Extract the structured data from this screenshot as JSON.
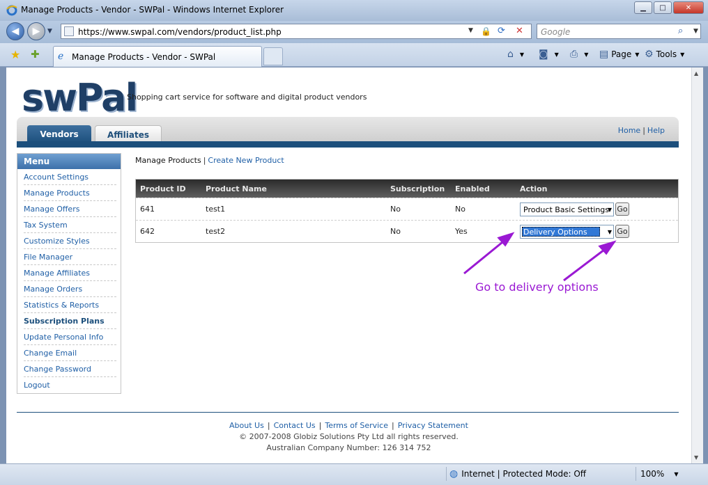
{
  "window": {
    "title": "Manage Products - Vendor - SWPal - Windows Internet Explorer",
    "buttons": {
      "minimize": "▁",
      "maximize": "□",
      "close": "✕"
    }
  },
  "address": {
    "url": "https://www.swpal.com/vendors/product_list.php",
    "search_placeholder": "Google"
  },
  "tabs": {
    "active_label": "Manage Products - Vendor - SWPal",
    "commands": {
      "page": "Page",
      "tools": "Tools"
    }
  },
  "site": {
    "logo": "swPal",
    "tagline": "Shopping cart service for software and digital product vendors",
    "main_tabs": [
      "Vendors",
      "Affiliates"
    ],
    "top_links": {
      "home": "Home",
      "help": "Help"
    }
  },
  "menu": {
    "header": "Menu",
    "items": [
      "Account Settings",
      "Manage Products",
      "Manage Offers",
      "Tax System",
      "Customize Styles",
      "File Manager",
      "Manage Affiliates",
      "Manage Orders",
      "Statistics & Reports",
      "Subscription Plans",
      "Update Personal Info",
      "Change Email",
      "Change Password",
      "Logout"
    ]
  },
  "breadcrumb": {
    "current": "Manage Products",
    "link": "Create New Product"
  },
  "table": {
    "headers": [
      "Product ID",
      "Product Name",
      "Subscription",
      "Enabled",
      "Action"
    ],
    "rows": [
      {
        "id": "641",
        "name": "test1",
        "subscription": "No",
        "enabled": "No",
        "action": "Product Basic Settings",
        "go": "Go"
      },
      {
        "id": "642",
        "name": "test2",
        "subscription": "No",
        "enabled": "Yes",
        "action": "Delivery Options",
        "go": "Go"
      }
    ]
  },
  "annotation": {
    "text": "Go to delivery options",
    "color": "#9a19d3"
  },
  "footer": {
    "links": [
      "About Us",
      "Contact Us",
      "Terms of Service",
      "Privacy Statement"
    ],
    "copyright": "© 2007-2008 Globiz Solutions Pty Ltd all rights reserved.",
    "acn": "Australian Company Number: 126 314 752"
  },
  "status": {
    "zone": "Internet | Protected Mode: Off",
    "zoom": "100%"
  },
  "colors": {
    "brand_dark": "#1c4f7c",
    "link": "#1f5fa6"
  }
}
